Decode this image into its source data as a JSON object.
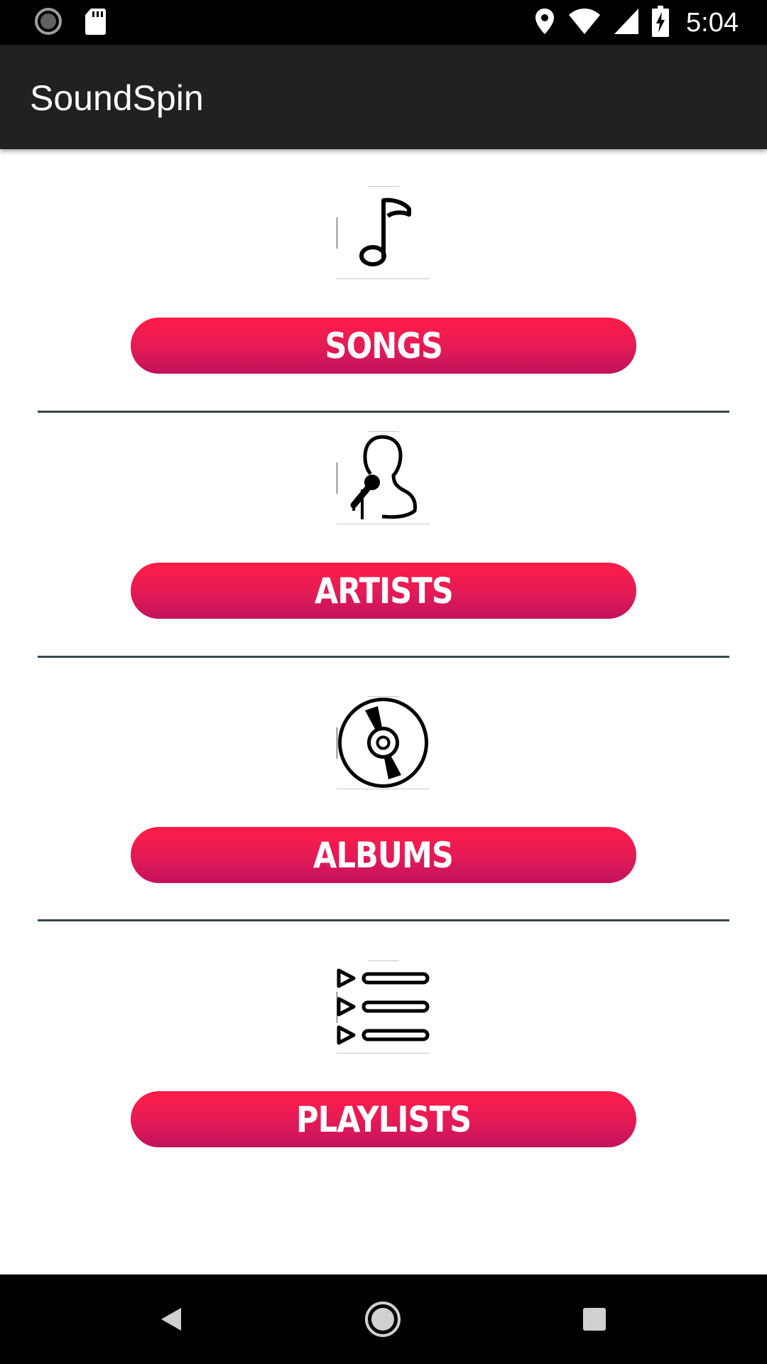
{
  "status_bar": {
    "time": "5:04",
    "left_icons": [
      "sync-icon",
      "sd-card-icon"
    ],
    "right_icons": [
      "location-icon",
      "wifi-icon",
      "signal-icon",
      "battery-charging-icon"
    ]
  },
  "app_bar": {
    "title": "SoundSpin"
  },
  "menu": {
    "items": [
      {
        "label": "SONGS",
        "icon": "music-note-icon"
      },
      {
        "label": "ARTISTS",
        "icon": "singer-microphone-icon"
      },
      {
        "label": "ALBUMS",
        "icon": "disc-icon"
      },
      {
        "label": "PLAYLISTS",
        "icon": "playlist-icon"
      }
    ]
  },
  "colors": {
    "button_top": "#ff1c48",
    "button_bottom": "#c2125c",
    "app_bar": "#212121",
    "divider": "#37474f"
  },
  "nav_bar": {
    "buttons": [
      "back-icon",
      "home-icon",
      "recents-icon"
    ]
  }
}
